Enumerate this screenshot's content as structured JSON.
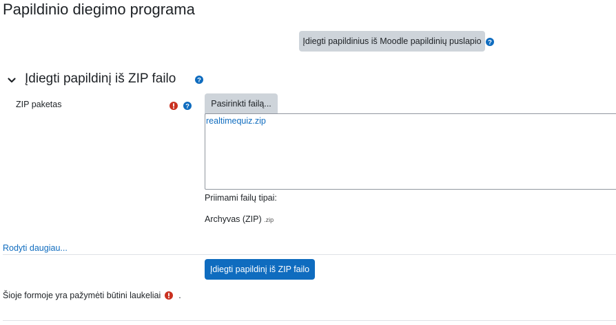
{
  "page_title": "Papildinio diegimo programa",
  "top_button": {
    "label": "Įdiegti papildinius iš Moodle papildinių puslapio"
  },
  "section": {
    "heading": "Įdiegti papildinį iš ZIP failo",
    "expanded": true
  },
  "zip_field": {
    "label": "ZIP paketas",
    "choose_button": "Pasirinkti failą...",
    "selected_file": "realtimequiz.zip",
    "accepted_types_label": "Priimami failų tipai:",
    "accepted_type_name": "Archyvas (ZIP)",
    "accepted_type_ext": ".zip"
  },
  "show_more_link": "Rodyti daugiau...",
  "submit_button": {
    "label": "Įdiegti papildinį iš ZIP failo"
  },
  "required_notice": {
    "text": "Šioje formoje yra pažymėti būtini laukeliai",
    "suffix": "."
  },
  "colors": {
    "primary": "#0f6cbf",
    "secondary_button": "#ced4da",
    "help_icon": "#0f6cbf",
    "required_icon": "#ca3120",
    "text": "#1d2125",
    "border": "#8f959e",
    "divider": "#dee2e6"
  }
}
